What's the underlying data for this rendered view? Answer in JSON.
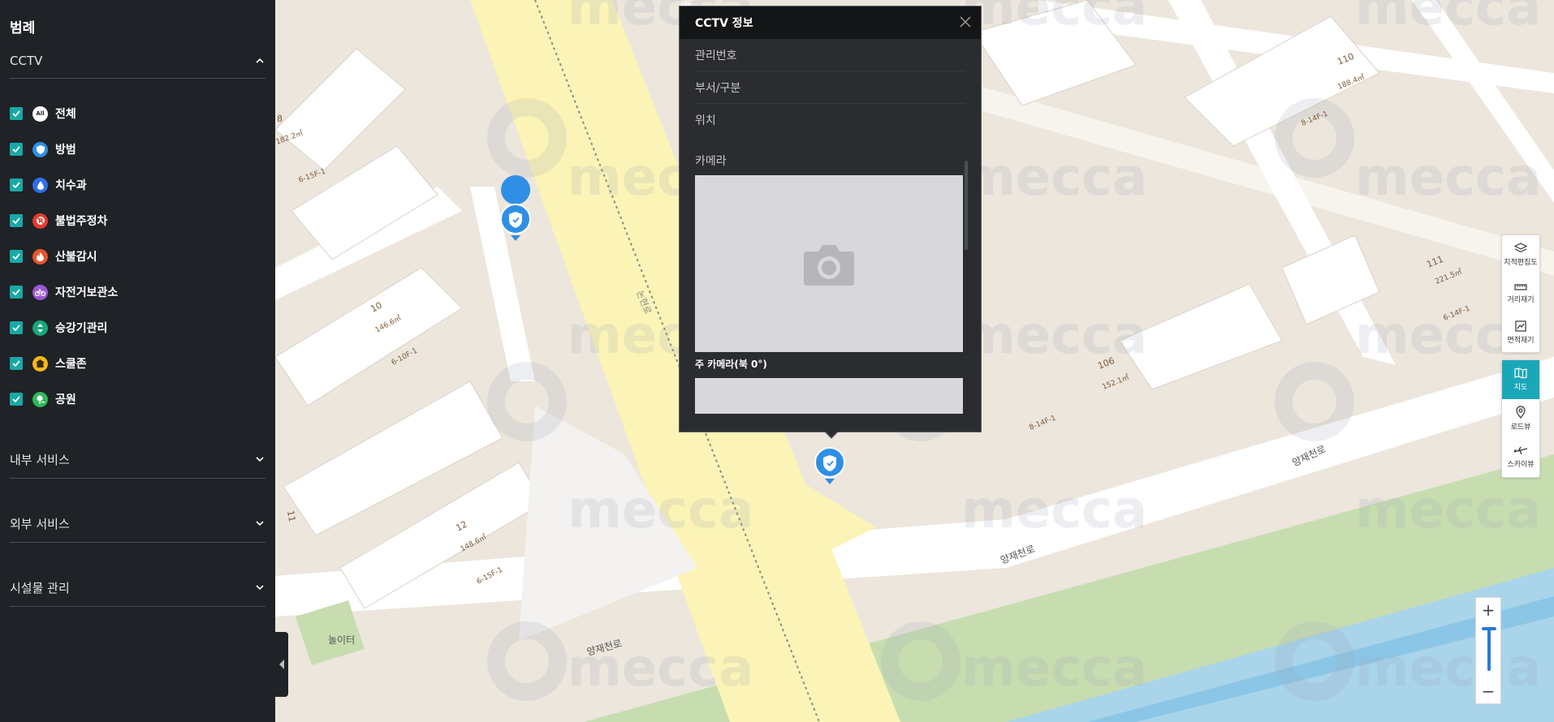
{
  "sidebar": {
    "title": "범례",
    "cctv_header": "CCTV",
    "items": [
      {
        "label": "전체",
        "icon": "all-icon",
        "color": "#ffffff",
        "glyph": "All"
      },
      {
        "label": "방범",
        "icon": "shield-icon",
        "color": "#2f8fe6",
        "glyph": ""
      },
      {
        "label": "치수과",
        "icon": "water-drop-icon",
        "color": "#2f6fe6",
        "glyph": ""
      },
      {
        "label": "불법주정차",
        "icon": "no-parking-icon",
        "color": "#e63a2f",
        "glyph": ""
      },
      {
        "label": "산불감시",
        "icon": "fire-icon",
        "color": "#e6552f",
        "glyph": ""
      },
      {
        "label": "자전거보관소",
        "icon": "bicycle-icon",
        "color": "#9b59d6",
        "glyph": ""
      },
      {
        "label": "승강기관리",
        "icon": "elevator-icon",
        "color": "#19a67a",
        "glyph": ""
      },
      {
        "label": "스쿨존",
        "icon": "school-icon",
        "color": "#f5b81a",
        "glyph": ""
      },
      {
        "label": "공원",
        "icon": "park-icon",
        "color": "#2fb85a",
        "glyph": ""
      }
    ],
    "sections": [
      "내부 서비스",
      "외부 서비스",
      "시설물 관리"
    ]
  },
  "popup": {
    "title": "CCTV 정보",
    "rows": [
      "관리번호",
      "부서/구분",
      "위치"
    ],
    "camera_label": "카메라",
    "camera_caption": "주 카메라(북 0°)"
  },
  "map": {
    "watermark": "mecca",
    "labels": {
      "street_a": "양재천로",
      "street_b": "양재천로",
      "street_c": "양재천로",
      "playground": "놀이터",
      "road_name": "논현로",
      "b110": "110",
      "b110_area": "188.4㎡",
      "b111": "111",
      "b111_area": "221.5㎡",
      "b106": "106",
      "b106_area": "152.1㎡",
      "b10": "10",
      "b10_area": "146.6㎡",
      "b12": "12",
      "b12_area": "148.6㎡",
      "b8": "8",
      "b8_area": "182.2㎡",
      "b11": "11",
      "f_8_14": "8-14F-1",
      "f_6_14": "6-14F-1",
      "f_6_15": "6-15F-1",
      "f_6_10": "6-10F-1",
      "f_8_14b": "8-14F-1",
      "f_6_15b": "6-15F-1"
    }
  },
  "tools": {
    "group1": [
      "지적편집도",
      "거리재기",
      "면적재기"
    ],
    "group2": [
      "지도",
      "로드뷰",
      "스카이뷰"
    ]
  },
  "zoom": {
    "plus": "+",
    "minus": "−",
    "level": 0.9
  },
  "colors": {
    "accent": "#1aa8b8",
    "checkbox": "#18a9a6",
    "marker": "#2f8fe6"
  }
}
